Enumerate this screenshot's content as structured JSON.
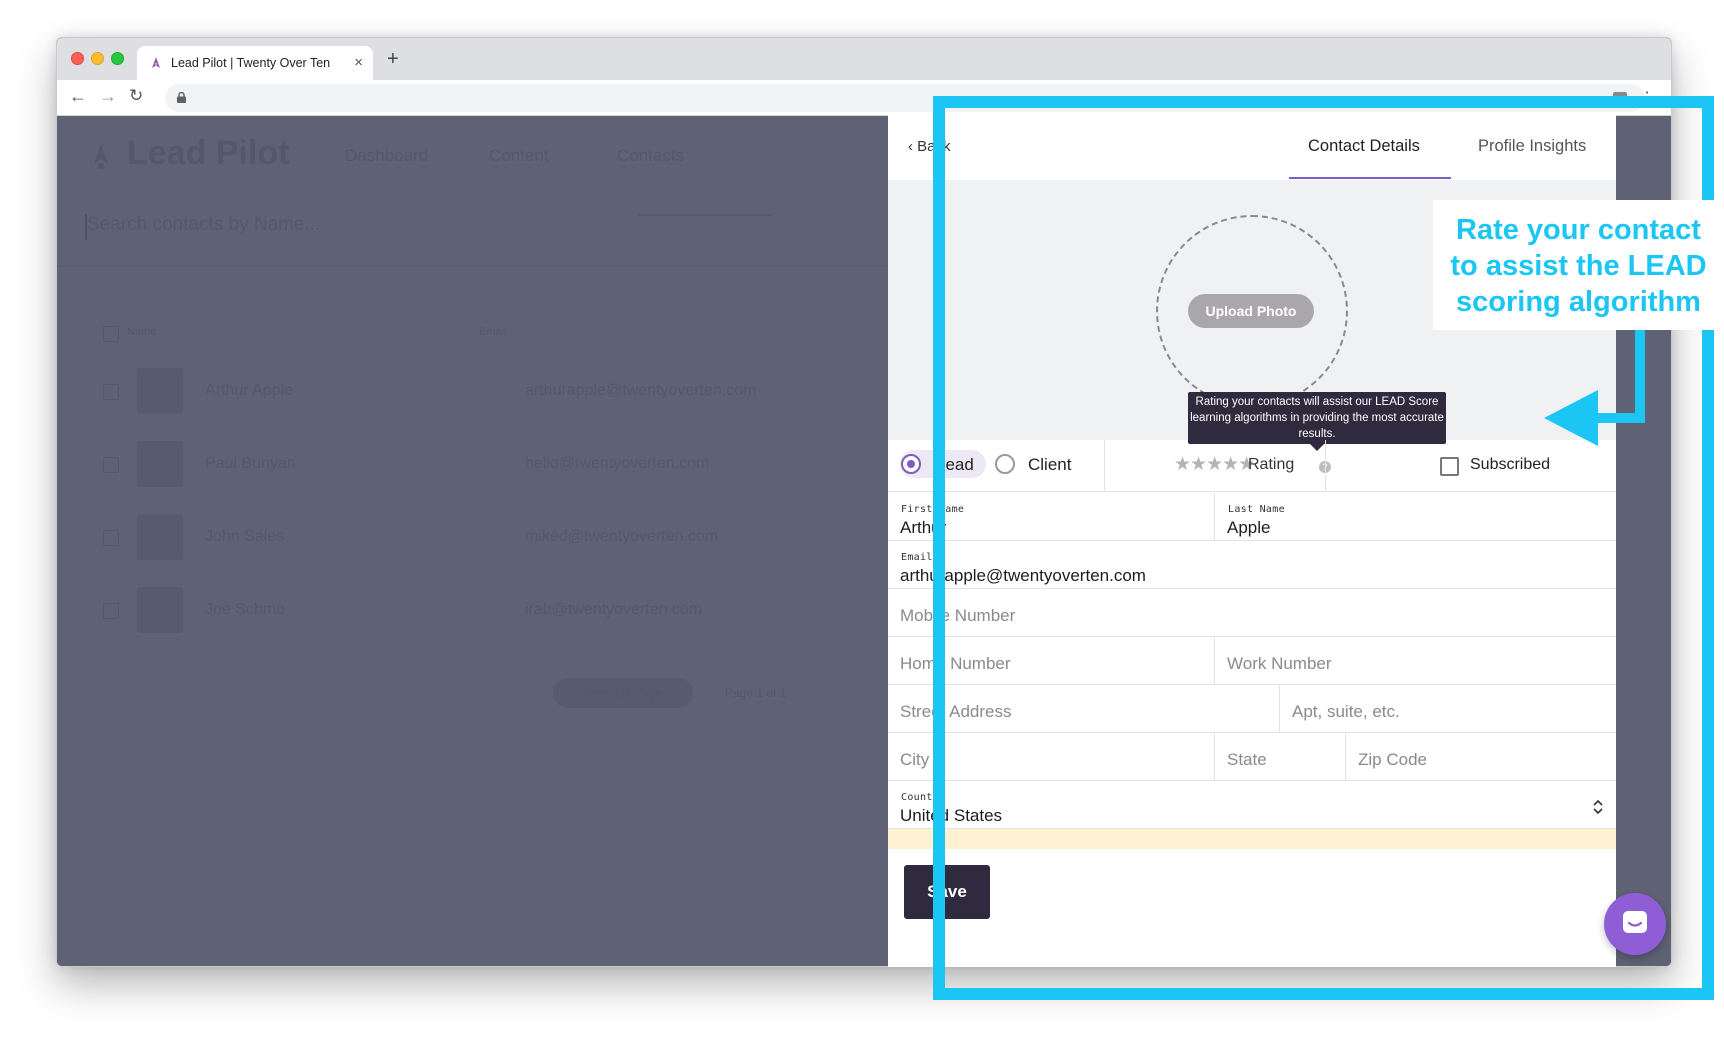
{
  "browser": {
    "tab_title": "Lead Pilot | Twenty Over Ten",
    "tab_close": "×",
    "new_tab": "+"
  },
  "background_app": {
    "logo": "Lead Pilot",
    "nav": [
      "Dashboard",
      "Content",
      "Contacts"
    ],
    "search_placeholder": "Search contacts by Name...",
    "columns": [
      "Name",
      "Email"
    ],
    "contacts": [
      {
        "name": "Arthur Apple",
        "email": "arthurapple@twentyoverten.com"
      },
      {
        "name": "Paul Bunyan",
        "email": "hello@twentyoverten.com"
      },
      {
        "name": "John Sales",
        "email": "miked@twentyoverten.com"
      },
      {
        "name": "Joe Schmo",
        "email": "irab@twentyoverten.com"
      }
    ],
    "pager_button": "Previous Page",
    "pager_text": "Page 1 of 1"
  },
  "panel": {
    "back": "Back",
    "tabs": [
      "Contact Details",
      "Profile Insights"
    ],
    "upload_photo": "Upload Photo",
    "tooltip": "Rating your contacts will assist our LEAD Score learning algorithms in providing the most accurate results.",
    "type_options": [
      "Lead",
      "Client"
    ],
    "selected_type": "Lead",
    "rating_label": "Rating",
    "rating_stars": "★★★★★",
    "rating_value": 0,
    "subscribed_label": "Subscribed",
    "subscribed": false,
    "fields": {
      "first_name_label": "First Name",
      "first_name": "Arthur",
      "last_name_label": "Last Name",
      "last_name": "Apple",
      "email_label": "Email",
      "email": "arthurapple@twentyoverten.com",
      "mobile_placeholder": "Mobile Number",
      "home_placeholder": "Home Number",
      "work_placeholder": "Work Number",
      "street_placeholder": "Street Address",
      "apt_placeholder": "Apt, suite, etc.",
      "city_placeholder": "City",
      "state_placeholder": "State",
      "zip_placeholder": "Zip Code",
      "country_label": "Country",
      "country": "United States"
    },
    "save": "Save"
  },
  "annotation": {
    "callout_lines": [
      "Rate your contact",
      "to assist the LEAD",
      "scoring algorithm"
    ],
    "color": "#1bc5f4"
  },
  "colors": {
    "accent": "#7c5dc7",
    "dark_button": "#2f2a3e",
    "chat": "#8f5ed6",
    "overlay": "#5f6175"
  }
}
